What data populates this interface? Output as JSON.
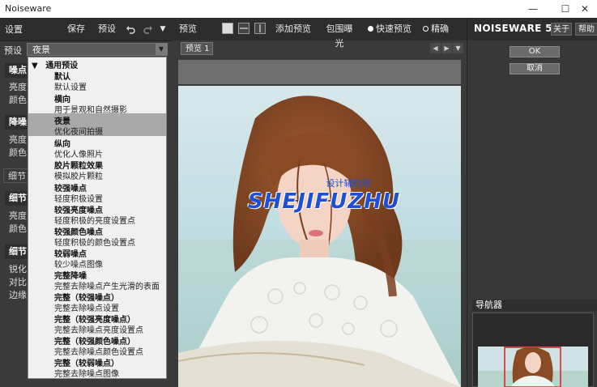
{
  "window": {
    "title": "Noiseware",
    "minimize_glyph": "—",
    "maximize_glyph": "☐",
    "close_glyph": "✕"
  },
  "left_panel": {
    "settings_label": "设置",
    "save_label": "保存",
    "preset_btn_label": "预设",
    "undo_icon": "undo-icon",
    "redo_icon": "redo-icon",
    "menu_icon": "dropdown-arrow-icon",
    "preset_row_label": "预设",
    "preset_selected": "夜景",
    "background_labels": [
      {
        "text": "噪点",
        "kind": "header"
      },
      {
        "text": "亮度",
        "kind": "label"
      },
      {
        "text": "颜色",
        "kind": "label"
      },
      {
        "text": "降噪",
        "kind": "header"
      },
      {
        "text": "亮度",
        "kind": "label"
      },
      {
        "text": "颜色",
        "kind": "label"
      },
      {
        "text": "细节",
        "kind": "tab"
      },
      {
        "text": "细节",
        "kind": "header"
      },
      {
        "text": "亮度",
        "kind": "label"
      },
      {
        "text": "颜色",
        "kind": "label"
      },
      {
        "text": "细节",
        "kind": "header"
      },
      {
        "text": "锐化",
        "kind": "label"
      },
      {
        "text": "对比",
        "kind": "label"
      },
      {
        "text": "边缘",
        "kind": "label"
      }
    ]
  },
  "dropdown": {
    "group_label": "通用预设",
    "items": [
      {
        "name": "默认",
        "desc": "默认设置",
        "selected": false
      },
      {
        "name": "横向",
        "desc": "用于景观和自然摄影",
        "selected": false
      },
      {
        "name": "夜景",
        "desc": "优化夜间拍摄",
        "selected": true
      },
      {
        "name": "纵向",
        "desc": "优化人像照片",
        "selected": false
      },
      {
        "name": "胶片颗粒效果",
        "desc": "模拟胶片颗粒",
        "selected": false
      },
      {
        "name": "较强噪点",
        "desc": "轻度积极设置",
        "selected": false
      },
      {
        "name": "较强亮度噪点",
        "desc": "轻度积极的亮度设置点",
        "selected": false
      },
      {
        "name": "较强颜色噪点",
        "desc": "轻度积极的颜色设置点",
        "selected": false
      },
      {
        "name": "较弱噪点",
        "desc": "较少噪点图像",
        "selected": false
      },
      {
        "name": "完整降噪",
        "desc": "完整去除噪点产生光滑的表面",
        "selected": false
      },
      {
        "name": "完整（较强噪点）",
        "desc": "完整去除噪点设置",
        "selected": false
      },
      {
        "name": "完整（较强亮度噪点）",
        "desc": "完整去除噪点亮度设置点",
        "selected": false
      },
      {
        "name": "完整（较强颜色噪点）",
        "desc": "完整去除噪点颜色设置点",
        "selected": false
      },
      {
        "name": "完整（较弱噪点）",
        "desc": "完整去除噪点图像",
        "selected": false
      }
    ]
  },
  "center_panel": {
    "preview_label": "预览",
    "add_preview_label": "添加预览",
    "clip_exposure_label": "包围曝光",
    "fast_preview_label": "快速预览",
    "accurate_label": "精确",
    "tab_label": "预览 1",
    "watermark_main": "SHEJIFUZHU",
    "watermark_sub": "设计辅助网"
  },
  "right_panel": {
    "brand": "NOISEWARE 5",
    "about_label": "关于",
    "help_label": "帮助",
    "ok_label": "OK",
    "cancel_label": "取消",
    "navigator_label": "导航器"
  },
  "colors": {
    "panel_bg": "#3a3a3a",
    "toolbar_bg": "#2d2d2d",
    "dropdown_bg": "#f0f0f0",
    "dropdown_selected": "#a9a9a9",
    "watermark_blue": "#1e4fd6",
    "navigator_frame": "#d42020"
  }
}
